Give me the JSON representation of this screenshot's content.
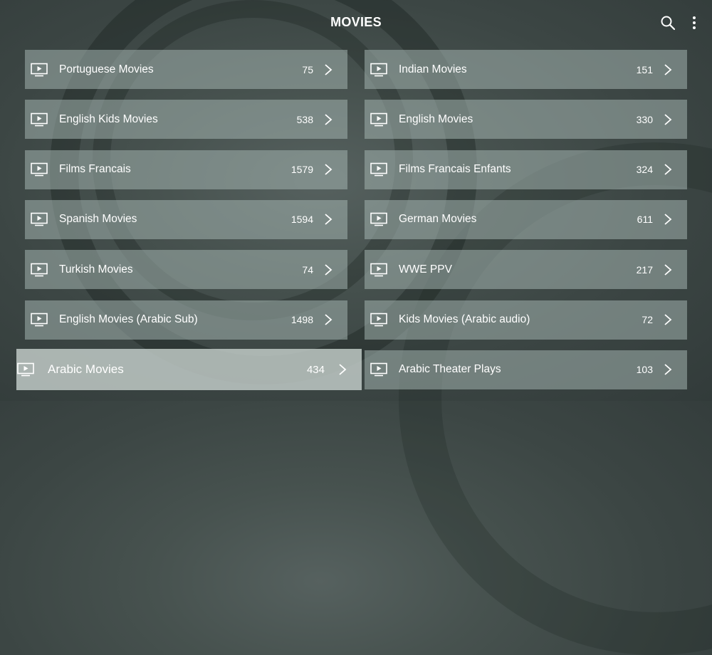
{
  "header": {
    "title": "MOVIES",
    "search_icon": "search-icon",
    "menu_icon": "more-vertical-icon"
  },
  "categories": [
    {
      "label": "Portuguese Movies",
      "count": "75"
    },
    {
      "label": "Indian Movies",
      "count": "151"
    },
    {
      "label": "English Kids Movies",
      "count": "538"
    },
    {
      "label": "English Movies",
      "count": "330"
    },
    {
      "label": "Films Francais",
      "count": "1579"
    },
    {
      "label": "Films Francais Enfants",
      "count": "324"
    },
    {
      "label": "Spanish Movies",
      "count": "1594"
    },
    {
      "label": "German Movies",
      "count": "611"
    },
    {
      "label": "Turkish Movies",
      "count": "74"
    },
    {
      "label": "WWE PPV",
      "count": "217"
    },
    {
      "label": "English Movies (Arabic Sub)",
      "count": "1498"
    },
    {
      "label": "Kids Movies (Arabic audio)",
      "count": "72"
    },
    {
      "label": "Arabic Movies",
      "count": "434",
      "focused": true
    },
    {
      "label": "Arabic Theater Plays",
      "count": "103"
    }
  ],
  "item_icon": "tv-play-icon",
  "item_arrow_icon": "chevron-right-icon"
}
